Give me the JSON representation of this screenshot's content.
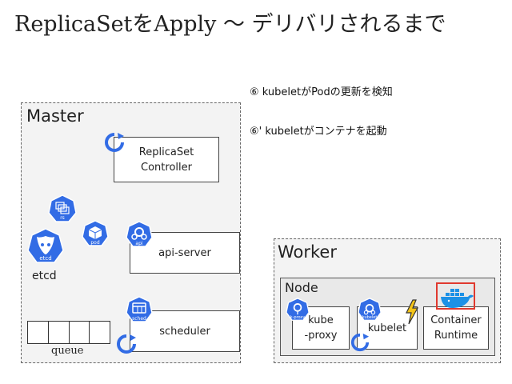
{
  "title": "ReplicaSetをApply 〜 デリバリされるまで",
  "notes": {
    "step6": "⑥ kubeletがPodの更新を検知",
    "step6b": "⑥' kubeletがコンテナを起動"
  },
  "master": {
    "label": "Master",
    "controller_box": "ReplicaSet\nController",
    "api_box": "api-server",
    "scheduler_box": "scheduler",
    "etcd_label": "etcd",
    "queue_label": "queue",
    "icons": {
      "rs": "rs",
      "pod": "pod",
      "etcd": "etcd",
      "api": "api",
      "sched": "sched"
    }
  },
  "worker": {
    "label": "Worker",
    "node_label": "Node",
    "kube_proxy_box": "kube\n-proxy",
    "kubelet_box": "kubelet",
    "container_box": "Container\nRuntime",
    "icons": {
      "kproxy": "k-proxy",
      "kubelet": "kubelet"
    }
  },
  "colors": {
    "k8s_blue": "#326ce5",
    "highlight": "#e03a2f",
    "lightning": "#f5c518",
    "docker_blue": "#1d91e6"
  }
}
